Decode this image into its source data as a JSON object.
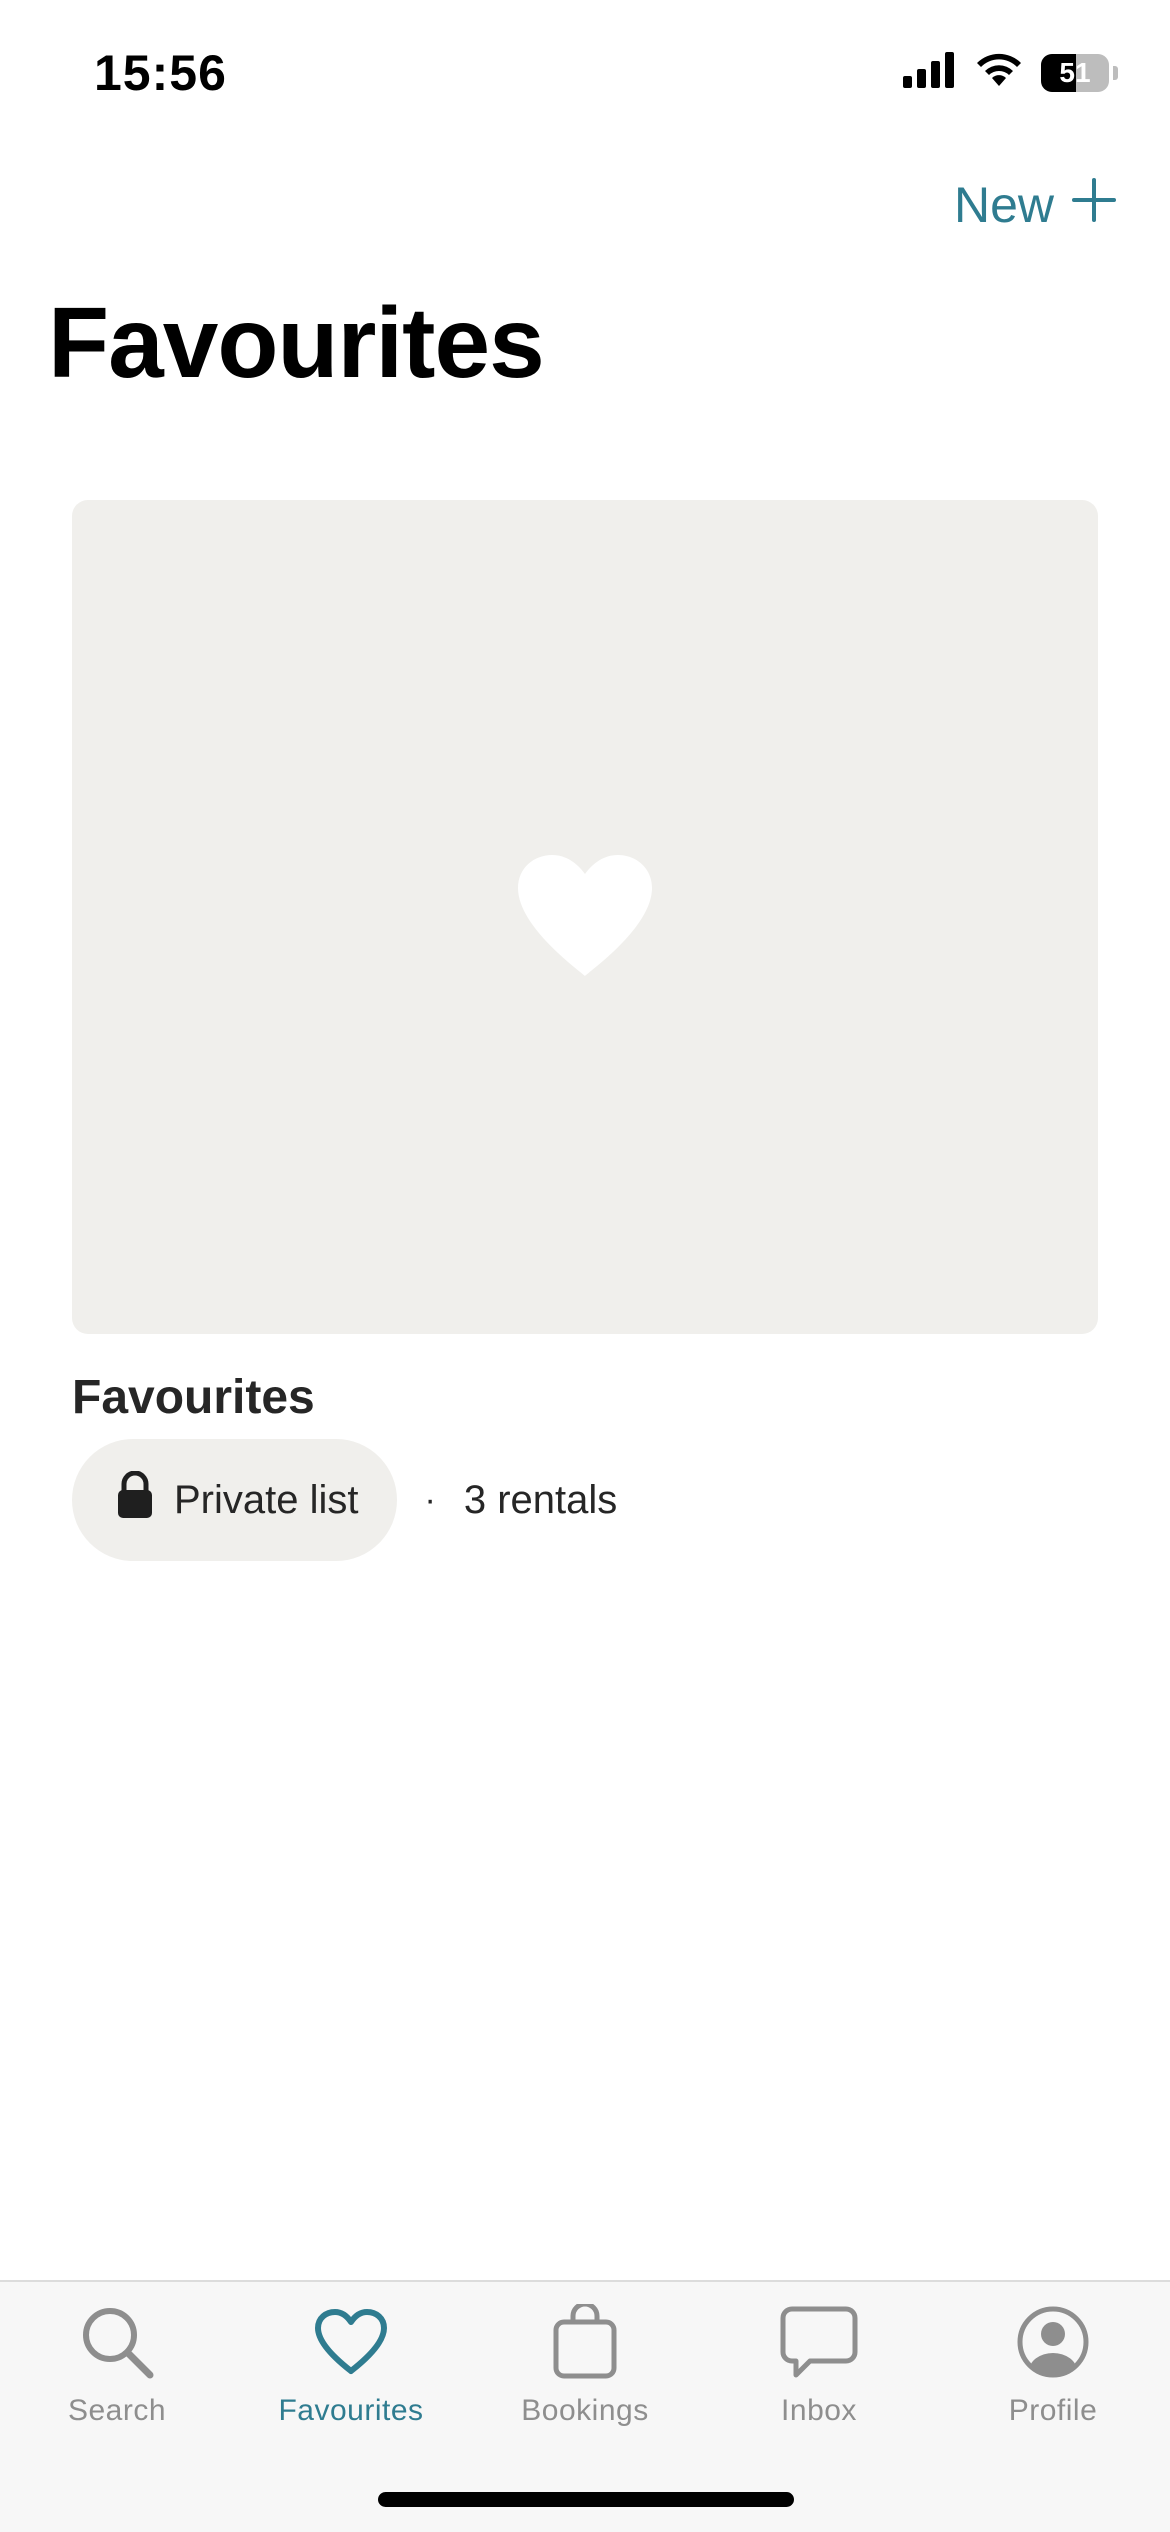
{
  "status_bar": {
    "time": "15:56",
    "battery_level": "51",
    "battery_fraction": 0.51,
    "icons": [
      "signal-icon",
      "wifi-icon",
      "battery-icon"
    ]
  },
  "header": {
    "new_label": "New",
    "new_icon": "plus-icon",
    "title": "Favourites"
  },
  "list": {
    "title": "Favourites",
    "privacy_label": "Private list",
    "privacy_icon": "lock-icon",
    "separator": "·",
    "rental_count": "3 rentals",
    "cover_icon": "heart-icon"
  },
  "tab_bar": {
    "items": [
      {
        "label": "Search",
        "icon": "search-icon",
        "active": false
      },
      {
        "label": "Favourites",
        "icon": "heart-outline-icon",
        "active": true
      },
      {
        "label": "Bookings",
        "icon": "bag-icon",
        "active": false
      },
      {
        "label": "Inbox",
        "icon": "chat-bubble-icon",
        "active": false
      },
      {
        "label": "Profile",
        "icon": "profile-icon",
        "active": false
      }
    ]
  },
  "colors": {
    "accent": "#2f7c90",
    "card_background": "#f0efec",
    "tab_inactive": "#8e8e8e",
    "tab_bar_background": "#f7f7f7"
  }
}
